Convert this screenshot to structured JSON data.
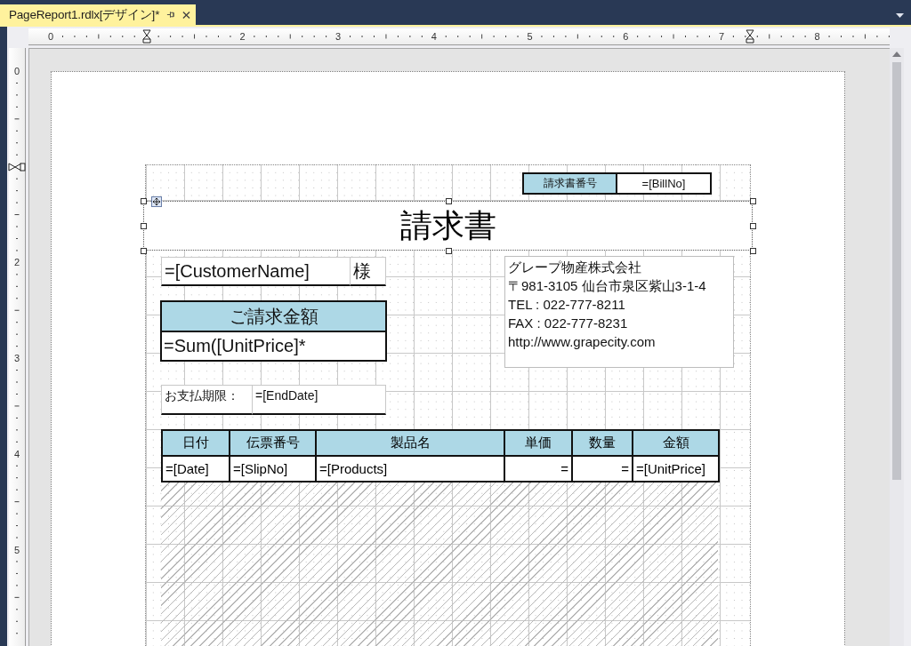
{
  "tab": {
    "title": "PageReport1.rdlx[デザイン]*"
  },
  "horizontal_ruler": {
    "numbers": [
      "0",
      "2",
      "3",
      "4",
      "5",
      "6",
      "7",
      "8"
    ]
  },
  "vertical_ruler": {
    "numbers": [
      "0",
      "2",
      "3",
      "4",
      "5"
    ]
  },
  "report": {
    "bill_no": {
      "label": "請求書番号",
      "value": "=[BillNo]"
    },
    "title": {
      "text": "請求書",
      "selected": true
    },
    "customer": {
      "name": "=[CustomerName]",
      "honorific": "様"
    },
    "amount": {
      "label": "ご請求金額",
      "value": "=Sum([UnitPrice]*"
    },
    "due": {
      "label": "お支払期限：",
      "value": "=[EndDate]"
    },
    "company_lines": [
      "グレープ物産株式会社",
      "〒981-3105 仙台市泉区紫山3-1-4",
      "TEL : 022-777-8211",
      "FAX : 022-777-8231",
      "http://www.grapecity.com"
    ],
    "table": {
      "columns": [
        "日付",
        "伝票番号",
        "製品名",
        "単価",
        "数量",
        "金額"
      ],
      "row": [
        {
          "text": "=[Date]",
          "right_aligned": false
        },
        {
          "text": "=[SlipNo]",
          "right_aligned": false
        },
        {
          "text": "=[Products]",
          "right_aligned": false
        },
        {
          "text": "=",
          "right_aligned": true
        },
        {
          "text": "=",
          "right_aligned": true
        },
        {
          "text": "=[UnitPrice]",
          "right_aligned": false
        }
      ]
    }
  }
}
